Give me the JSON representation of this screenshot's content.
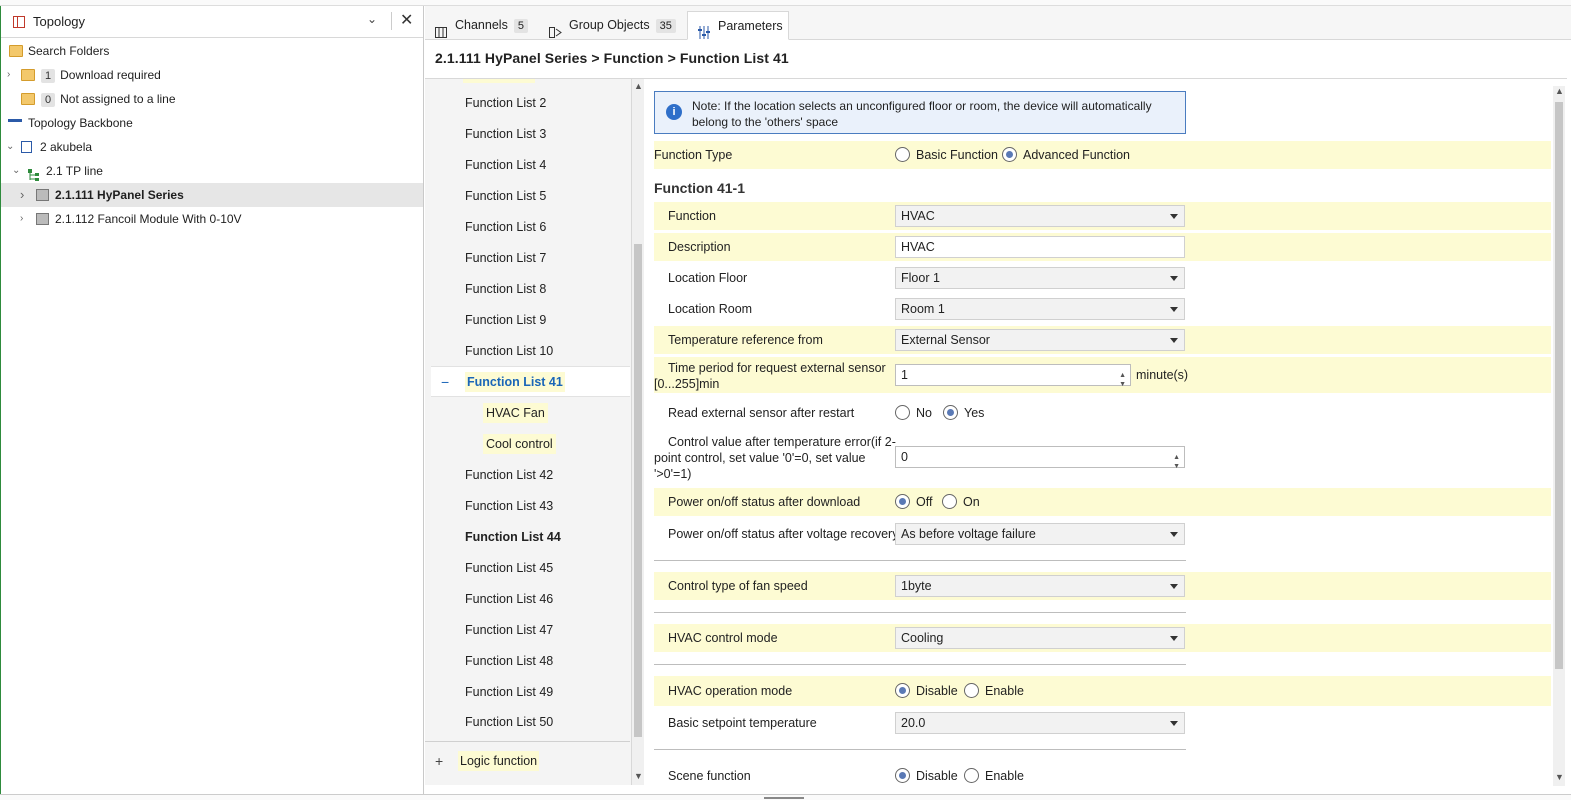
{
  "left_panel": {
    "title": "Topology",
    "tree": [
      {
        "label": "Search Folders",
        "badge": ""
      },
      {
        "label": "Download required",
        "badge": "1"
      },
      {
        "label": "Not assigned to a line",
        "badge": "0"
      },
      {
        "label": "Topology Backbone",
        "badge": ""
      },
      {
        "label": "2 akubela",
        "badge": ""
      },
      {
        "label": "2.1 TP line",
        "badge": ""
      },
      {
        "label": "2.1.111 HyPanel Series",
        "badge": ""
      },
      {
        "label": "2.1.112 Fancoil Module With 0-10V",
        "badge": ""
      }
    ]
  },
  "tabs": [
    {
      "label": "Channels",
      "count": "5"
    },
    {
      "label": "Group Objects",
      "count": "35"
    },
    {
      "label": "Parameters",
      "count": ""
    }
  ],
  "breadcrumb": "2.1.111 HyPanel Series > Function > Function List 41",
  "function_list": {
    "items": [
      "Function List 2",
      "Function List 3",
      "Function List 4",
      "Function List 5",
      "Function List 6",
      "Function List 7",
      "Function List 8",
      "Function List 9",
      "Function List 10",
      "Function List 41",
      "HVAC Fan",
      "Cool control",
      "Function List 42",
      "Function List 43",
      "Function List 44",
      "Function List 45",
      "Function List 46",
      "Function List 47",
      "Function List 48",
      "Function List 49",
      "Function List 50"
    ],
    "logic_label": "Logic function"
  },
  "params": {
    "note": "Note: If the location selects an unconfigured floor or room, the device will automatically belong to the 'others' space",
    "function_type": {
      "label": "Function Type",
      "opt1": "Basic Function",
      "opt2": "Advanced Function"
    },
    "section_title": "Function 41-1",
    "function": {
      "label": "Function",
      "value": "HVAC"
    },
    "description": {
      "label": "Description",
      "value": "HVAC"
    },
    "location_floor": {
      "label": "Location Floor",
      "value": "Floor 1"
    },
    "location_room": {
      "label": "Location Room",
      "value": "Room 1"
    },
    "temp_ref": {
      "label": "Temperature reference from",
      "value": "External Sensor"
    },
    "time_period": {
      "label_line1": "Time period for request external sensor",
      "label_line2": "[0...255]min",
      "value": "1",
      "unit": "minute(s)"
    },
    "read_ext": {
      "label": "Read external sensor after restart",
      "opt1": "No",
      "opt2": "Yes"
    },
    "control_value": {
      "line1": "Control value after temperature error(if 2-",
      "line2": "point control, set value '0'=0, set value",
      "line3": "'>0'=1)",
      "value": "0"
    },
    "power_dl": {
      "label": "Power on/off status after download",
      "opt1": "Off",
      "opt2": "On"
    },
    "power_vr": {
      "label": "Power on/off status after voltage recovery",
      "value": "As before voltage failure"
    },
    "fan_speed": {
      "label": "Control type of fan speed",
      "value": "1byte"
    },
    "hvac_mode": {
      "label": "HVAC control mode",
      "value": "Cooling"
    },
    "hvac_op": {
      "label": "HVAC operation mode",
      "opt1": "Disable",
      "opt2": "Enable"
    },
    "setpoint": {
      "label": "Basic setpoint temperature",
      "value": "20.0"
    },
    "scene": {
      "label": "Scene function",
      "opt1": "Disable",
      "opt2": "Enable"
    }
  }
}
